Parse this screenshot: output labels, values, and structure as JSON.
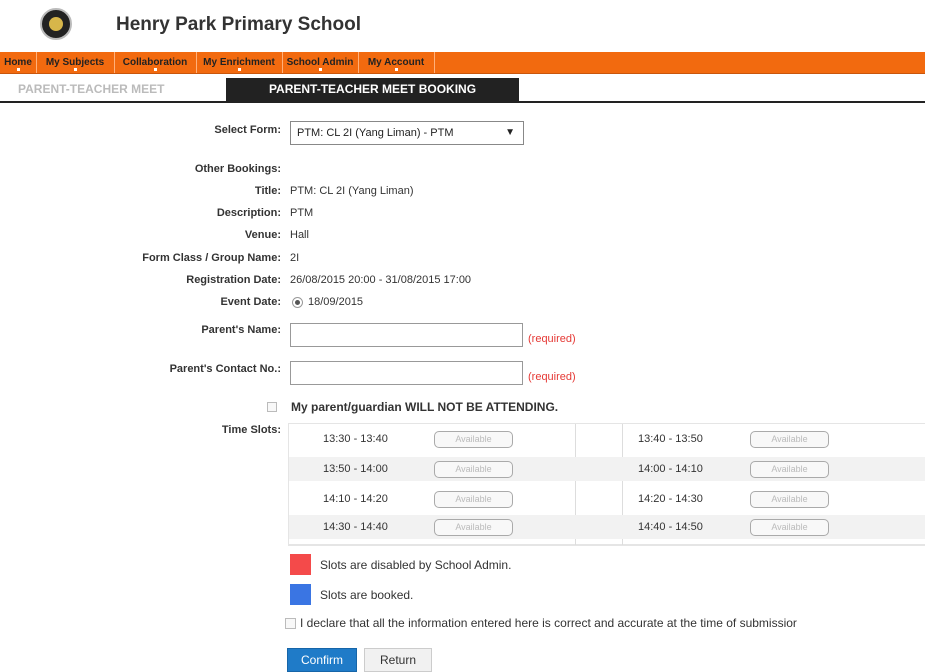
{
  "school": {
    "name": "Henry Park Primary School"
  },
  "nav": {
    "items": [
      "Home",
      "My Subjects",
      "Collaboration",
      "My Enrichment",
      "School Admin",
      "My Account"
    ],
    "color": "#f26a0f"
  },
  "tabs": {
    "inactive": "PARENT-TEACHER MEET",
    "active": "PARENT-TEACHER MEET BOOKING"
  },
  "form": {
    "select_form_label": "Select Form:",
    "select_form_value": "PTM: CL 2I (Yang Liman) - PTM",
    "other_bookings_label": "Other Bookings:",
    "title_label": "Title:",
    "title_value": "PTM: CL 2I (Yang Liman)",
    "description_label": "Description:",
    "description_value": "PTM",
    "venue_label": "Venue:",
    "venue_value": "Hall",
    "form_class_label": "Form Class / Group Name:",
    "form_class_value": "2I",
    "registration_label": "Registration Date:",
    "registration_value": "26/08/2015 20:00 - 31/08/2015 17:00",
    "event_date_label": "Event Date:",
    "event_date_value": "18/09/2015",
    "parent_name_label": "Parent's Name:",
    "parent_name_value": "",
    "parent_contact_label": "Parent's Contact No.:",
    "parent_contact_value": "",
    "required_text": "(required)",
    "not_attending_label": "My parent/guardian WILL NOT BE ATTENDING.",
    "time_slots_label": "Time Slots:"
  },
  "slots": [
    {
      "left_time": "13:30 - 13:40",
      "left_status": "Available",
      "right_time": "13:40 - 13:50",
      "right_status": "Available"
    },
    {
      "left_time": "13:50 - 14:00",
      "left_status": "Available",
      "right_time": "14:00 - 14:10",
      "right_status": "Available"
    },
    {
      "left_time": "14:10 - 14:20",
      "left_status": "Available",
      "right_time": "14:20 - 14:30",
      "right_status": "Available"
    },
    {
      "left_time": "14:30 - 14:40",
      "left_status": "Available",
      "right_time": "14:40 - 14:50",
      "right_status": "Available"
    }
  ],
  "legend": {
    "disabled_text": "Slots are disabled by School Admin.",
    "disabled_color": "#f44a4a",
    "booked_text": "Slots are booked.",
    "booked_color": "#3a75e3"
  },
  "declaration": "I declare that all the information entered here is correct and accurate at the time of submissior",
  "buttons": {
    "confirm": "Confirm",
    "return": "Return"
  }
}
